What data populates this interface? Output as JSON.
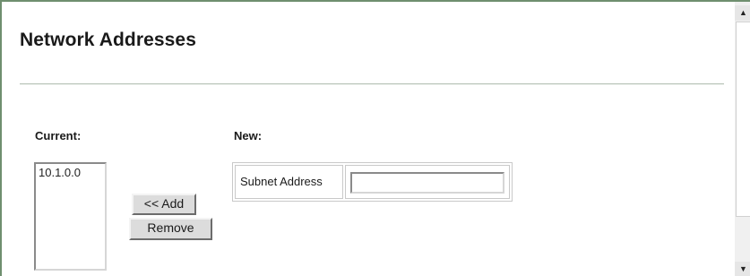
{
  "page": {
    "title": "Network Addresses"
  },
  "current": {
    "label": "Current:",
    "items": [
      "10.1.0.0"
    ]
  },
  "new": {
    "label": "New:",
    "subnet_label": "Subnet Address",
    "subnet_value": ""
  },
  "buttons": {
    "add_label": "<< Add",
    "remove_label": "Remove"
  },
  "scrollbar": {
    "up_icon": "scroll-up-arrow",
    "down_icon": "scroll-down-arrow"
  }
}
